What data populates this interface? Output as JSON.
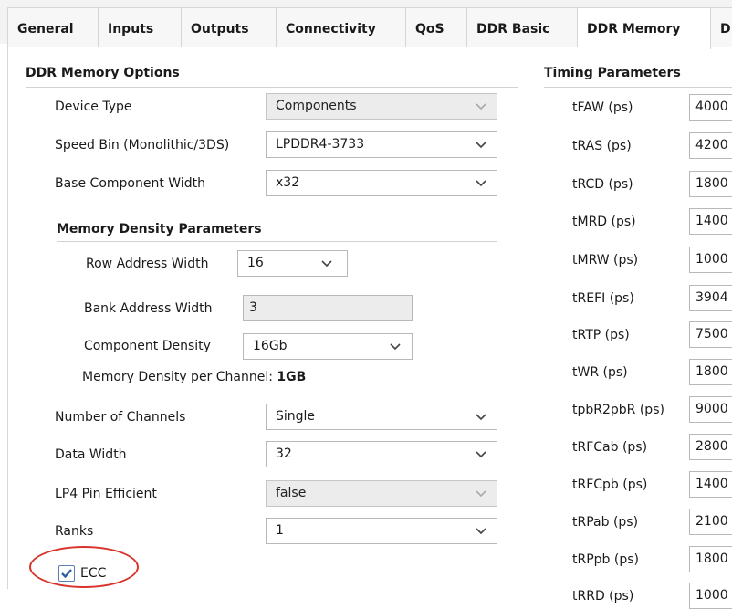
{
  "tabs": [
    "General",
    "Inputs",
    "Outputs",
    "Connectivity",
    "QoS",
    "DDR Basic",
    "DDR Memory",
    "D"
  ],
  "active_tab": "DDR Memory",
  "ddr_memory_options": {
    "title": "DDR Memory Options",
    "device_type": {
      "label": "Device Type",
      "value": "Components",
      "enabled": false
    },
    "speed_bin": {
      "label": "Speed Bin (Monolithic/3DS)",
      "value": "LPDDR4-3733"
    },
    "base_component_width": {
      "label": "Base Component Width",
      "value": "x32"
    },
    "memory_density": {
      "title": "Memory Density Parameters",
      "row_address_width": {
        "label": "Row Address Width",
        "value": "16"
      },
      "bank_address_width": {
        "label": "Bank Address Width",
        "value": "3"
      },
      "component_density": {
        "label": "Component Density",
        "value": "16Gb"
      },
      "density_per_channel_label": "Memory Density per Channel:",
      "density_per_channel_value": "1GB"
    },
    "number_of_channels": {
      "label": "Number of Channels",
      "value": "Single"
    },
    "data_width": {
      "label": "Data Width",
      "value": "32"
    },
    "lp4_pin_efficient": {
      "label": "LP4 Pin Efficient",
      "value": "false",
      "enabled": false
    },
    "ranks": {
      "label": "Ranks",
      "value": "1"
    },
    "ecc": {
      "label": "ECC",
      "checked": true
    }
  },
  "timing_parameters": {
    "title": "Timing Parameters",
    "rows": [
      {
        "label": "tFAW (ps)",
        "value": "4000"
      },
      {
        "label": "tRAS (ps)",
        "value": "4200"
      },
      {
        "label": "tRCD (ps)",
        "value": "1800"
      },
      {
        "label": "tMRD (ps)",
        "value": "1400"
      },
      {
        "label": "tMRW (ps)",
        "value": "1000"
      },
      {
        "label": "tREFI (ps)",
        "value": "3904"
      },
      {
        "label": "tRTP (ps)",
        "value": "7500"
      },
      {
        "label": "tWR (ps)",
        "value": "1800"
      },
      {
        "label": "tpbR2pbR (ps)",
        "value": "9000"
      },
      {
        "label": "tRFCab (ps)",
        "value": "2800"
      },
      {
        "label": "tRFCpb (ps)",
        "value": "1400"
      },
      {
        "label": "tRPab (ps)",
        "value": "2100"
      },
      {
        "label": "tRPpb (ps)",
        "value": "1800"
      },
      {
        "label": "tRRD (ps)",
        "value": "1000"
      }
    ]
  },
  "colors": {
    "highlight": "#d9342b",
    "check_accent": "#2f5f9e"
  }
}
